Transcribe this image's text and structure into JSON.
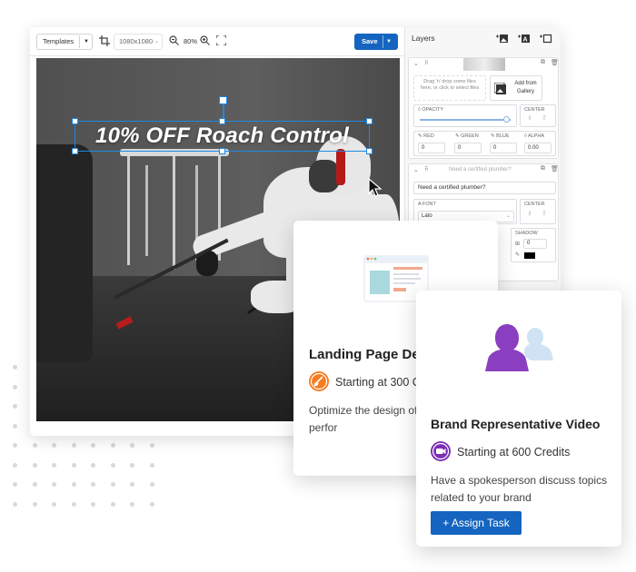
{
  "editor": {
    "toolbar": {
      "templates_label": "Templates",
      "canvas_size": "1080x1080",
      "zoom": "80%",
      "save_label": "Save"
    },
    "headline_text": "10% OFF Roach Control",
    "layers_panel": {
      "title": "Layers",
      "image_layer": {
        "dropzone_text": "Drag 'n' drop some files here, or click to select files",
        "gallery_button": "Add from Gallery",
        "opacity_label": "OPACITY",
        "opacity_value": 0.95,
        "center_label": "CENTER",
        "red_label": "RED",
        "green_label": "GREEN",
        "blue_label": "BLUE",
        "alpha_label": "ALPHA",
        "red_value": "0",
        "green_value": "0",
        "blue_value": "0",
        "alpha_value": "0.00"
      },
      "text_layer": {
        "header_placeholder": "Need a certified plumber?",
        "text_value": "Need a certified plumber?",
        "font_label": "FONT",
        "font_value": "Lato",
        "center_label": "CENTER",
        "shadow_label": "SHADOW",
        "shadow_value": "0"
      }
    }
  },
  "landing_card": {
    "title": "Landing Page Des",
    "price": "Starting at 300 Cr",
    "description": "Optimize the design of page to improve perfor",
    "badge_color": "#f57c20"
  },
  "brand_card": {
    "title": "Brand Representative Video",
    "price": "Starting at 600 Credits",
    "description": "Have a spokesperson discuss topics related to your brand",
    "button_label": "+ Assign Task",
    "badge_color": "#7b2fb5",
    "accent": "#1565c0"
  }
}
